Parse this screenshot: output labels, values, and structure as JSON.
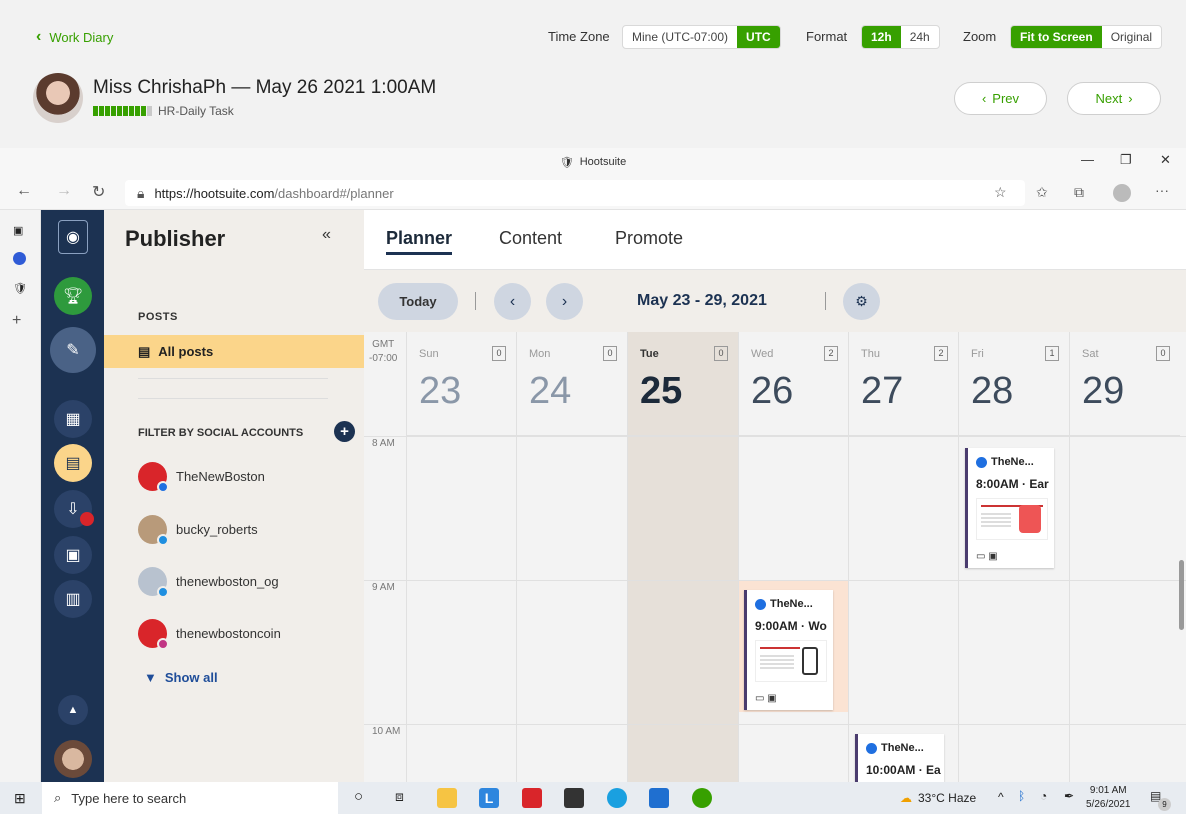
{
  "diary": {
    "back_label": "Work Diary",
    "timezone_label": "Time Zone",
    "tz_mine": "Mine (UTC-07:00)",
    "tz_utc": "UTC",
    "format_label": "Format",
    "fmt_12": "12h",
    "fmt_24": "24h",
    "zoom_label": "Zoom",
    "zoom_fit": "Fit to Screen",
    "zoom_original": "Original",
    "title": "Miss ChrishaPh — May 26 2021 1:00AM",
    "task": "HR-Daily Task",
    "activity_level": 0.9,
    "prev": "Prev",
    "next": "Next"
  },
  "browser": {
    "window_title": "Hootsuite",
    "url_host": "https://hootsuite.com",
    "url_path": "/dashboard#/planner"
  },
  "publisher": {
    "title": "Publisher",
    "posts_heading": "POSTS",
    "all_posts": "All posts",
    "filter_heading": "FILTER BY SOCIAL ACCOUNTS",
    "accounts": [
      {
        "name": "TheNewBoston"
      },
      {
        "name": "bucky_roberts"
      },
      {
        "name": "thenewboston_og"
      },
      {
        "name": "thenewbostoncoin"
      }
    ],
    "show_all": "Show all"
  },
  "planner": {
    "tabs": [
      "Planner",
      "Content",
      "Promote"
    ],
    "today": "Today",
    "range": "May 23 - 29, 2021",
    "gmt": "GMT",
    "gmt_offset": "-07:00",
    "days": [
      {
        "name": "Sun",
        "num": "23",
        "count": "0"
      },
      {
        "name": "Mon",
        "num": "24",
        "count": "0"
      },
      {
        "name": "Tue",
        "num": "25",
        "count": "0"
      },
      {
        "name": "Wed",
        "num": "26",
        "count": "2"
      },
      {
        "name": "Thu",
        "num": "27",
        "count": "2"
      },
      {
        "name": "Fri",
        "num": "28",
        "count": "1"
      },
      {
        "name": "Sat",
        "num": "29",
        "count": "0"
      }
    ],
    "hours": [
      "8 AM",
      "9 AM",
      "10 AM"
    ],
    "posts": [
      {
        "account": "TheNe...",
        "time": "8:00AM · Ear"
      },
      {
        "account": "TheNe...",
        "time": "9:00AM · Wo"
      },
      {
        "account": "TheNe...",
        "time": "10:00AM · Ea"
      }
    ]
  },
  "taskbar": {
    "search_placeholder": "Type here to search",
    "weather": "33°C  Haze",
    "time": "9:01 AM",
    "date": "5/26/2021",
    "notifications": "9"
  }
}
